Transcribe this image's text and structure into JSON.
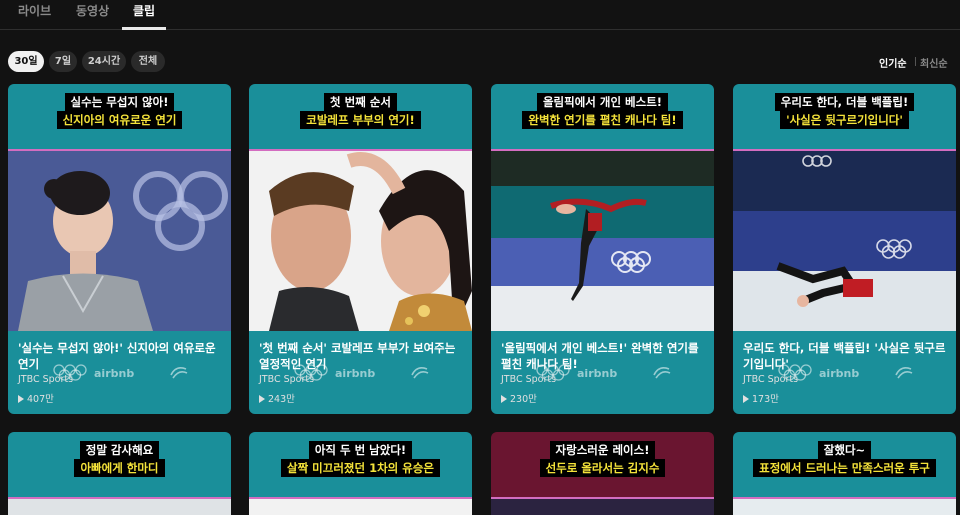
{
  "tabs": [
    {
      "label": "라이브"
    },
    {
      "label": "동영상"
    },
    {
      "label": "클립",
      "active": true
    }
  ],
  "filters": [
    {
      "label": "30일",
      "active": true
    },
    {
      "label": "7일"
    },
    {
      "label": "24시간"
    },
    {
      "label": "전체"
    }
  ],
  "sort": [
    {
      "label": "인기순",
      "active": true
    },
    {
      "label": "최신순"
    }
  ],
  "brand": {
    "name": "airbnb"
  },
  "cards": [
    {
      "caption_line1": "실수는 무섭지 않아!",
      "caption_line2": "신지아의 여유로운 연기",
      "title": "'실수는 무섭지 않아!' 신지아의 여유로운 연기",
      "source": "JTBC Sports",
      "views": "407만"
    },
    {
      "caption_line1": "첫 번째 순서",
      "caption_line2": "코발레프 부부의 연기!",
      "title": "'첫 번째 순서' 코발레프 부부가 보여주는 열정적인 연기",
      "source": "JTBC Sports",
      "views": "243만"
    },
    {
      "caption_line1": "올림픽에서 개인 베스트!",
      "caption_line2": "완벽한 연기를 펼친 캐나다 팀!",
      "title": "'올림픽에서 개인 베스트!' 완벽한 연기를 펼친 캐나다 팀!",
      "source": "JTBC Sports",
      "views": "230만"
    },
    {
      "caption_line1": "우리도 한다, 더블 백플립!",
      "caption_line2": "'사실은 뒷구르기입니다'",
      "title": "우리도 한다, 더블 백플립! '사실은 뒷구르기입니다'",
      "source": "JTBC Sports",
      "views": "173만"
    },
    {
      "caption_line1": "정말 감사해요",
      "caption_line2": "아빠에게 한마디"
    },
    {
      "caption_line1": "아직 두 번 남았다!",
      "caption_line2": "살짝 미끄러졌던 1차의 유승은"
    },
    {
      "caption_line1": "자랑스러운 레이스!",
      "caption_line2": "선두로 올라서는 김지수"
    },
    {
      "caption_line1": "잘했다~",
      "caption_line2": "표정에서 드러나는 만족스러운 투구"
    }
  ],
  "colors": {
    "background": "#121212",
    "card_teal": "#1a8f9a",
    "caption_yellow": "#f5e33a",
    "chip_bg": "#2a2a2a",
    "chip_active_bg": "#f1f1f1"
  }
}
